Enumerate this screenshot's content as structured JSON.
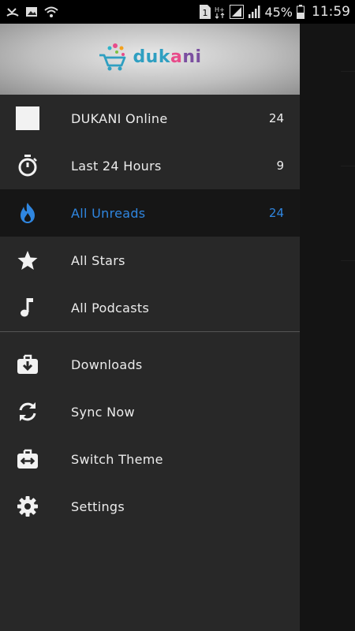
{
  "status_bar": {
    "notification_icons": [
      "missed-call-icon",
      "image-icon",
      "wifi-icon"
    ],
    "sim_label": "1",
    "network_label": "H+",
    "battery_percent": "45%",
    "time": "11:59"
  },
  "header": {
    "logo_text": "dukani"
  },
  "colors": {
    "accent": "#2f86e0",
    "drawer_bg": "#282828",
    "active_bg": "#161616"
  },
  "menu": [
    {
      "label": "DUKANI Online",
      "count": "24",
      "icon": "feed-square-icon",
      "active": false
    },
    {
      "label": "Last 24 Hours",
      "count": "9",
      "icon": "stopwatch-icon",
      "active": false
    },
    {
      "label": "All Unreads",
      "count": "24",
      "icon": "flame-icon",
      "active": true
    },
    {
      "label": "All Stars",
      "count": "",
      "icon": "star-icon",
      "active": false
    },
    {
      "label": "All Podcasts",
      "count": "",
      "icon": "music-note-icon",
      "active": false
    }
  ],
  "actions": [
    {
      "label": "Downloads",
      "icon": "download-box-icon"
    },
    {
      "label": "Sync Now",
      "icon": "sync-icon"
    },
    {
      "label": "Switch Theme",
      "icon": "switch-theme-icon"
    },
    {
      "label": "Settings",
      "icon": "gear-icon"
    }
  ]
}
